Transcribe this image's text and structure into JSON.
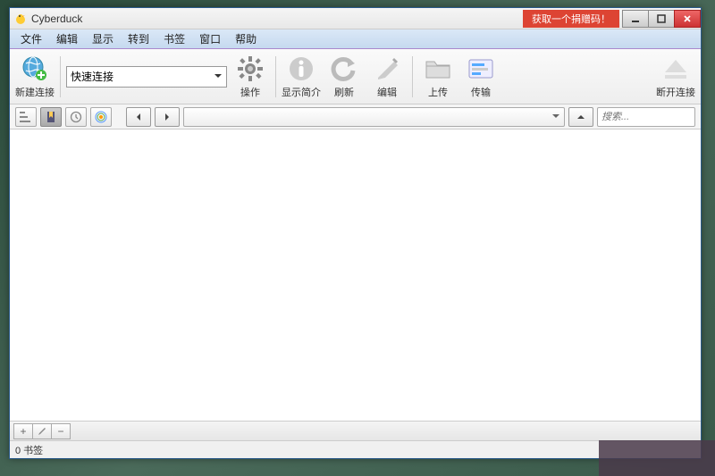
{
  "title": "Cyberduck",
  "donate": "获取一个捐赠码！",
  "menu": [
    "文件",
    "编辑",
    "显示",
    "转到",
    "书签",
    "窗口",
    "帮助"
  ],
  "toolbar": {
    "newconn": "新建连接",
    "quick": "快速连接",
    "action": "操作",
    "info": "显示简介",
    "refresh": "刷新",
    "edit": "编辑",
    "upload": "上传",
    "transfer": "传输",
    "disconnect": "断开连接"
  },
  "search_placeholder": "搜索...",
  "status": "0 书签"
}
